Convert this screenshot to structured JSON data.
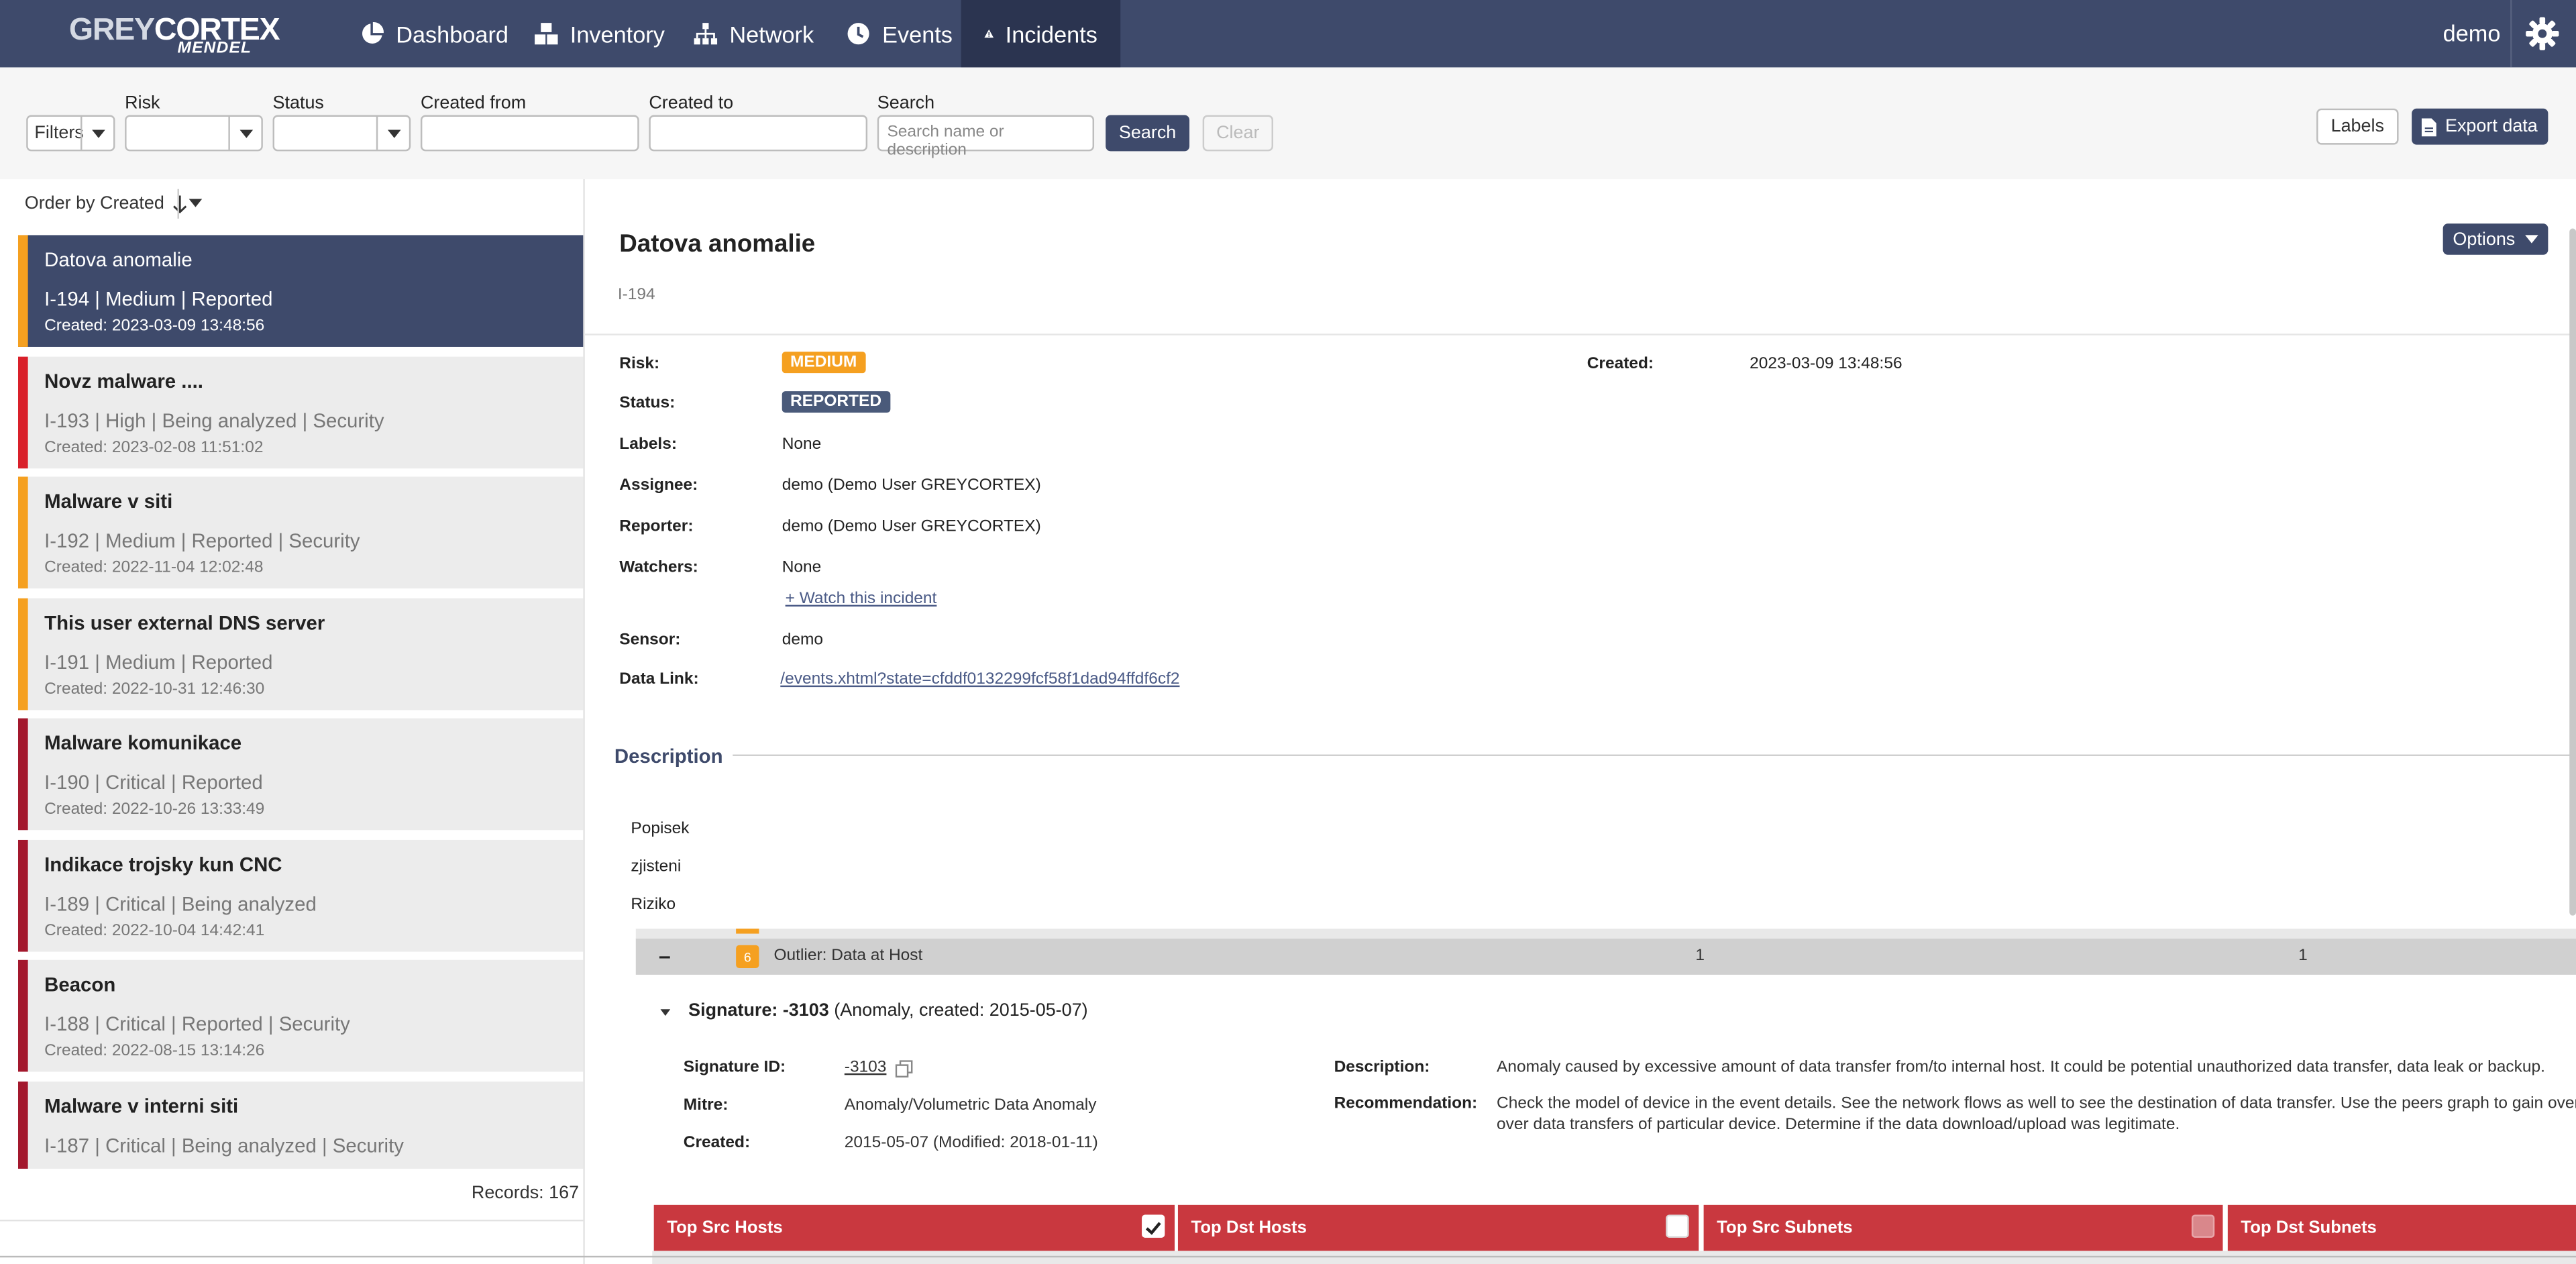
{
  "nav": {
    "logo_main_light": "GREY",
    "logo_main_bold": "CORTEX",
    "logo_sub": "MENDEL",
    "items": [
      {
        "label": "Dashboard",
        "icon": "pie-chart-icon"
      },
      {
        "label": "Inventory",
        "icon": "cubes-icon"
      },
      {
        "label": "Network",
        "icon": "sitemap-icon"
      },
      {
        "label": "Events",
        "icon": "clock-icon"
      },
      {
        "label": "Incidents",
        "icon": "warning-icon"
      }
    ],
    "active": "Incidents",
    "user": "demo",
    "colors": {
      "bar": "#3e4a6b",
      "active": "#2b3450"
    }
  },
  "filters": {
    "filters_label": "Filters",
    "risk_label": "Risk",
    "status_label": "Status",
    "created_from_label": "Created from",
    "created_to_label": "Created to",
    "search_label": "Search",
    "search_placeholder": "Search name or description",
    "search_button": "Search",
    "clear_button": "Clear",
    "labels_button": "Labels",
    "export_button": "Export data"
  },
  "list": {
    "order_by": "Order by Created",
    "records": "Records: 167",
    "items": [
      {
        "title": "Datova anomalie",
        "meta": "I-194 | Medium | Reported",
        "created": "Created: 2023-03-09 13:48:56",
        "color": "#f5a020"
      },
      {
        "title": "Novz malware ....",
        "meta": "I-193 | High | Being analyzed | Security",
        "created": "Created: 2023-02-08 11:51:02",
        "color": "#d9202a"
      },
      {
        "title": "Malware v siti",
        "meta": "I-192 | Medium | Reported | Security",
        "created": "Created: 2022-11-04 12:02:48",
        "color": "#f5a020"
      },
      {
        "title": "This user external DNS server",
        "meta": "I-191 | Medium | Reported",
        "created": "Created: 2022-10-31 12:46:30",
        "color": "#f5a020"
      },
      {
        "title": "Malware komunikace",
        "meta": "I-190 | Critical | Reported",
        "created": "Created: 2022-10-26 13:33:49",
        "color": "#a3182d"
      },
      {
        "title": "Indikace trojsky kun CNC",
        "meta": "I-189 | Critical | Being analyzed",
        "created": "Created: 2022-10-04 14:42:41",
        "color": "#a3182d"
      },
      {
        "title": "Beacon",
        "meta": "I-188 | Critical | Reported | Security",
        "created": "Created: 2022-08-15 13:14:26",
        "color": "#a3182d"
      },
      {
        "title": "Malware v interni siti",
        "meta": "I-187 | Critical | Being analyzed | Security",
        "created": "",
        "color": "#a3182d"
      }
    ]
  },
  "detail": {
    "title": "Datova anomalie",
    "id": "I-194",
    "options_button": "Options",
    "risk_label": "Risk:",
    "risk_value": "MEDIUM",
    "risk_color": "#f5a020",
    "status_label": "Status:",
    "status_value": "REPORTED",
    "status_color": "#4a5a7a",
    "created_label": "Created:",
    "created_value": "2023-03-09 13:48:56",
    "labels_label": "Labels:",
    "labels_value": "None",
    "assignee_label": "Assignee:",
    "assignee_value": "demo (Demo User GREYCORTEX)",
    "reporter_label": "Reporter:",
    "reporter_value": "demo (Demo User GREYCORTEX)",
    "watchers_label": "Watchers:",
    "watchers_value": "None",
    "watch_link": "+ Watch this incident",
    "sensor_label": "Sensor:",
    "sensor_value": "demo",
    "datalink_label": "Data Link:",
    "datalink_value": "/events.xhtml?state=cfddf0132299fcf58f1dad94ffdf6cf2",
    "description_heading": "Description",
    "description_lines": [
      "Popisek",
      "zjisteni",
      "Riziko"
    ],
    "outlier": {
      "count": "6",
      "title": "Outlier: Data at Host",
      "col1": "1",
      "col2": "1"
    },
    "signature": {
      "heading_bold": "Signature: -3103",
      "heading_rest": " (Anomaly, created: 2015-05-07)",
      "id_label": "Signature ID:",
      "id_value": "-3103",
      "mitre_label": "Mitre:",
      "mitre_value": "Anomaly/Volumetric Data Anomaly",
      "created_label": "Created:",
      "created_value": "2015-05-07 (Modified: 2018-01-11)",
      "desc_label": "Description:",
      "desc_value": "Anomaly caused by excessive amount of data transfer from/to internal host. It could be potential unauthorized data transfer, data leak or backup.",
      "rec_label": "Recommendation:",
      "rec_line1": "Check the model of device in the event details. See the network flows as well to see the destination of data transfer. Use the peers graph to gain overview",
      "rec_line2": "over data transfers of particular device. Determine if the data download/upload was legitimate."
    },
    "tables": [
      {
        "title": "Top Src Hosts",
        "checked": true
      },
      {
        "title": "Top Dst Hosts",
        "checked": false
      },
      {
        "title": "Top Src Subnets",
        "checked": false
      },
      {
        "title": "Top Dst Subnets",
        "checked": false
      }
    ],
    "table_color": "#c9383f"
  }
}
